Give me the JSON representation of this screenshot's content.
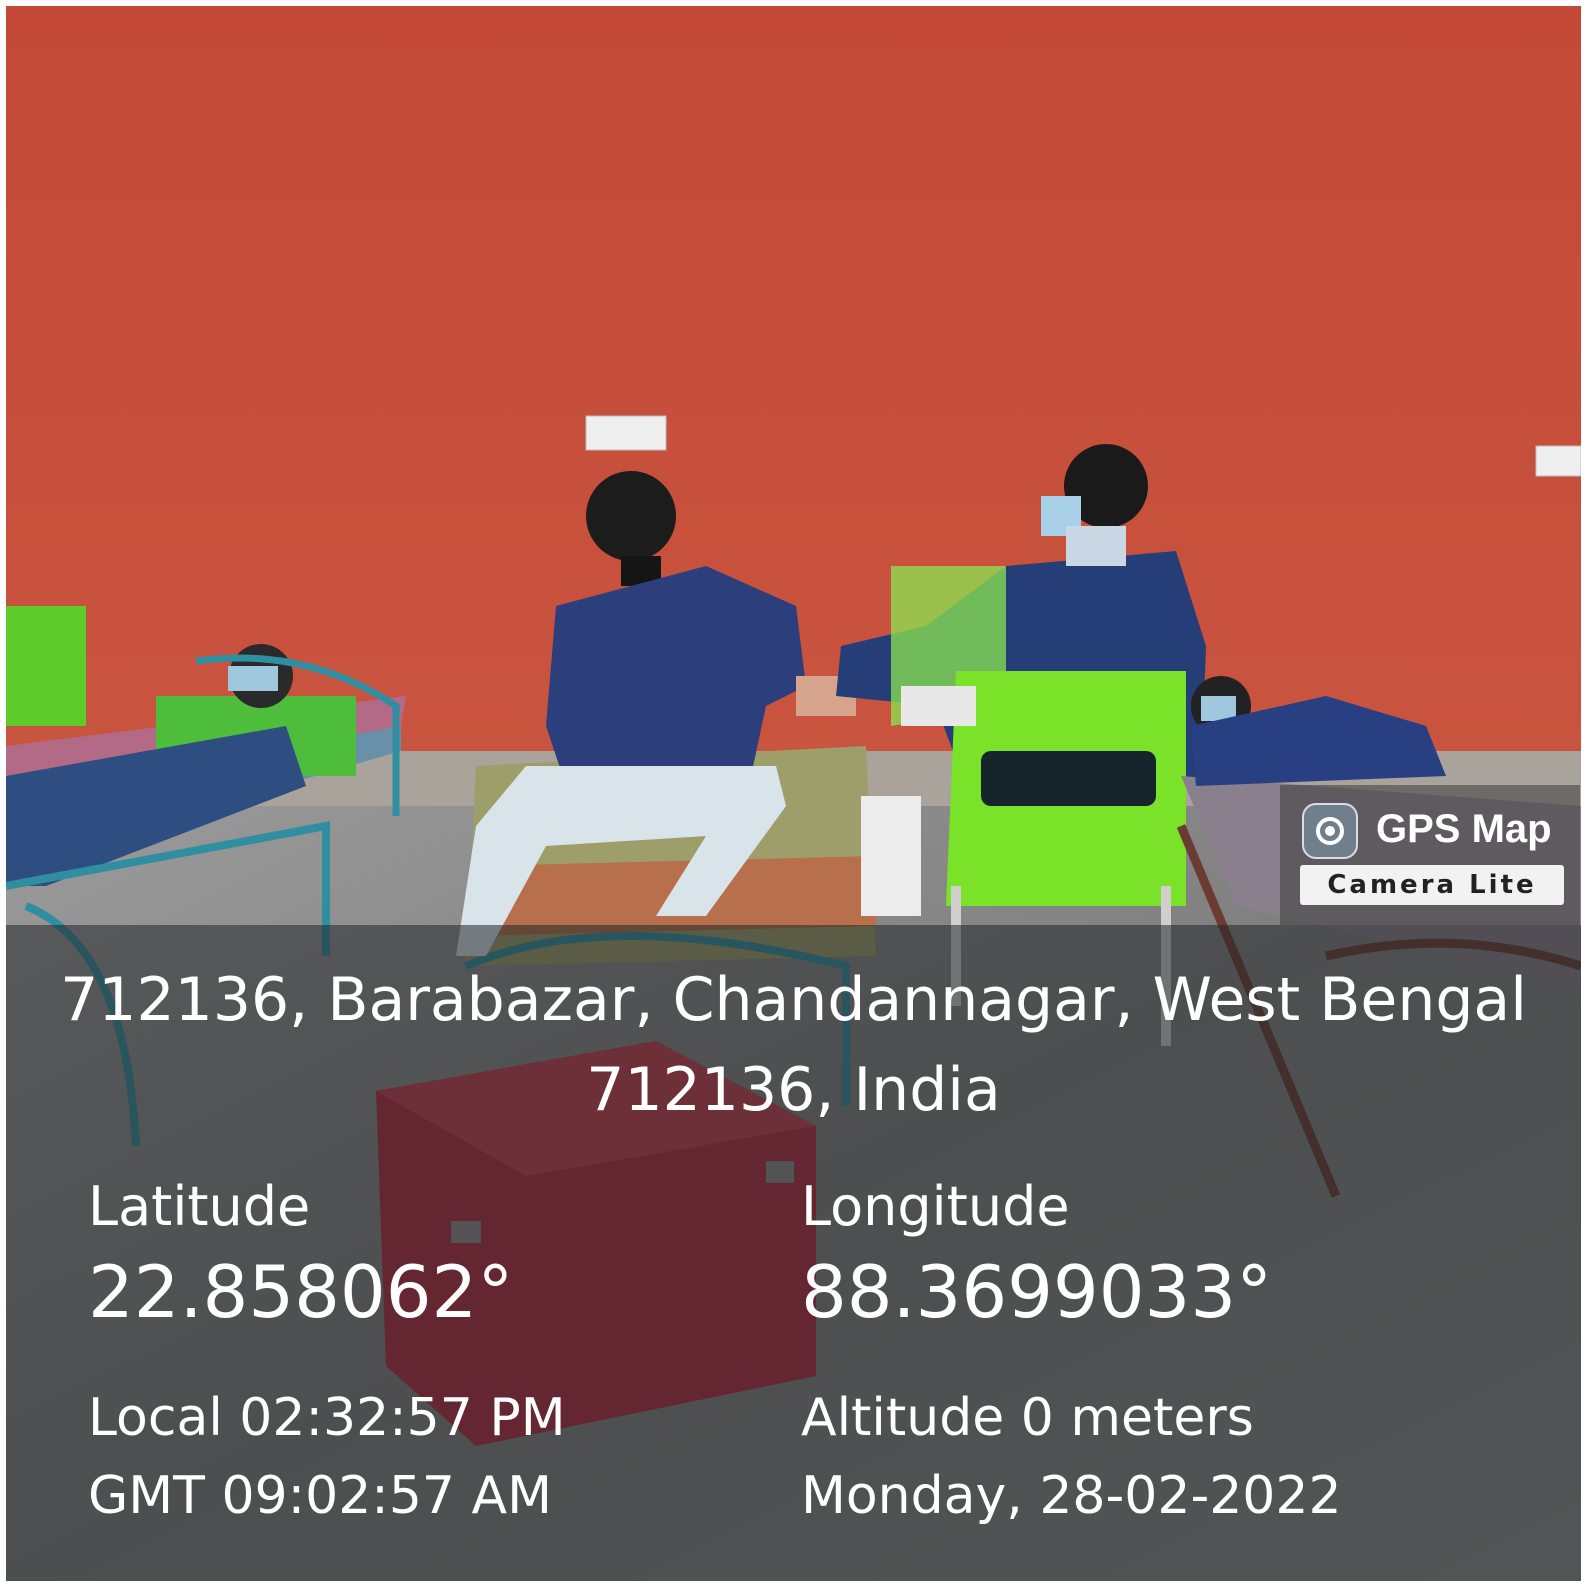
{
  "watermark": {
    "app_name": "GPS Map",
    "app_subtitle": "Camera Lite",
    "logo_icon": "camera-lens-icon"
  },
  "location": {
    "address_line1": "712136, Barabazar, Chandannagar, West Bengal",
    "address_line2": "712136, India"
  },
  "coordinates": {
    "latitude_label": "Latitude",
    "latitude_value": "22.858062°",
    "longitude_label": "Longitude",
    "longitude_value": "88.3699033°"
  },
  "time": {
    "local": "Local 02:32:57 PM",
    "gmt": "GMT 09:02:57 AM"
  },
  "details": {
    "altitude": "Altitude 0 meters",
    "date": "Monday, 28-02-2022"
  },
  "colors": {
    "wall": "#c9503c",
    "floor": "#8f8f8f",
    "chair_green": "#7ee82a",
    "cooler_red": "#b5283c"
  }
}
